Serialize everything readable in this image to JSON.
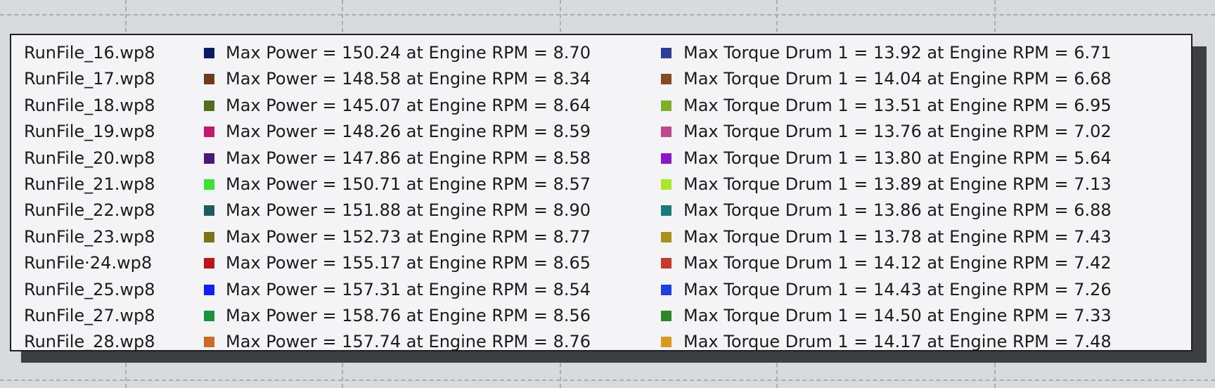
{
  "legend": {
    "rows": [
      {
        "file": "RunFile_16.wp8",
        "power": "Max Power = 150.24 at Engine RPM = 8.70",
        "torque": "Max Torque Drum 1 = 13.92 at Engine RPM = 6.71",
        "power_color": "#0c1a63",
        "torque_color": "#2a3d97"
      },
      {
        "file": "RunFile_17.wp8",
        "power": "Max Power = 148.58 at Engine RPM = 8.34",
        "torque": "Max Torque Drum 1 = 14.04 at Engine RPM = 6.68",
        "power_color": "#6e3a1c",
        "torque_color": "#8a4a20"
      },
      {
        "file": "RunFile_18.wp8",
        "power": "Max Power = 145.07 at Engine RPM = 8.64",
        "torque": "Max Torque Drum 1 = 13.51 at Engine RPM = 6.95",
        "power_color": "#4f6e1e",
        "torque_color": "#7fae2a"
      },
      {
        "file": "RunFile_19.wp8",
        "power": "Max Power = 148.26 at Engine RPM = 8.59",
        "torque": "Max Torque Drum 1 = 13.76 at Engine RPM = 7.02",
        "power_color": "#c4186c",
        "torque_color": "#c04888"
      },
      {
        "file": "RunFile_20.wp8",
        "power": "Max Power = 147.86 at Engine RPM = 8.58",
        "torque": "Max Torque Drum 1 = 13.80 at Engine RPM = 5.64",
        "power_color": "#4a1878",
        "torque_color": "#8a18c8"
      },
      {
        "file": "RunFile_21.wp8",
        "power": "Max Power = 150.71 at Engine RPM = 8.57",
        "torque": "Max Torque Drum 1 = 13.89 at Engine RPM = 7.13",
        "power_color": "#3ee038",
        "torque_color": "#a8e828"
      },
      {
        "file": "RunFile_22.wp8",
        "power": "Max Power = 151.88 at Engine RPM = 8.90",
        "torque": "Max Torque Drum 1 = 13.86 at Engine RPM = 6.88",
        "power_color": "#1e5c60",
        "torque_color": "#1a7a78"
      },
      {
        "file": "RunFile_23.wp8",
        "power": "Max Power = 152.73 at Engine RPM = 8.77",
        "torque": "Max Torque Drum 1 = 13.78 at Engine RPM = 7.43",
        "power_color": "#7e7218",
        "torque_color": "#a8901a"
      },
      {
        "file": "RunFile·24.wp8",
        "power": "Max Power = 155.17 at Engine RPM = 8.65",
        "torque": "Max Torque Drum 1 = 14.12 at Engine RPM = 7.42",
        "power_color": "#c01218",
        "torque_color": "#c83a28"
      },
      {
        "file": "RunFile_25.wp8",
        "power": "Max Power = 157.31 at Engine RPM = 8.54",
        "torque": "Max Torque Drum 1 = 14.43 at Engine RPM = 7.26",
        "power_color": "#1020f0",
        "torque_color": "#1a40e0"
      },
      {
        "file": "RunFile_27.wp8",
        "power": "Max Power = 158.76 at Engine RPM = 8.56",
        "torque": "Max Torque Drum 1 = 14.50 at Engine RPM = 7.33",
        "power_color": "#18943a",
        "torque_color": "#2a8a2a"
      },
      {
        "file": "RunFile_28.wp8",
        "power": "Max Power = 157.74 at Engine RPM = 8.76",
        "torque": "Max Torque Drum 1 = 14.17 at Engine RPM = 7.48",
        "power_color": "#cc6a28",
        "torque_color": "#d89a18"
      }
    ]
  }
}
